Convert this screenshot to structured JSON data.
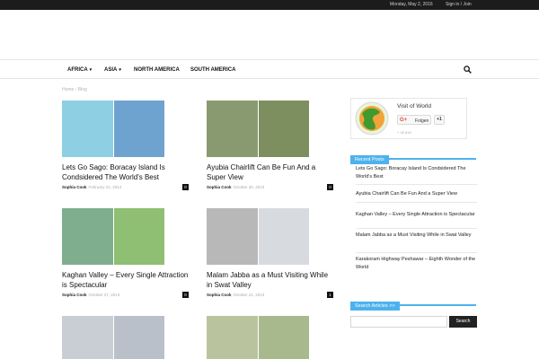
{
  "topbar": {
    "date": "Monday, May 2, 2016",
    "signin": "Sign in / Join"
  },
  "nav": {
    "items": [
      {
        "label": "AFRICA",
        "has_caret": true
      },
      {
        "label": "ASIA",
        "has_caret": true
      },
      {
        "label": "NORTH AMERICA",
        "has_caret": false
      },
      {
        "label": "SOUTH AMERICA",
        "has_caret": false
      }
    ],
    "search_icon": "search-icon"
  },
  "breadcrumb": {
    "home": "Home",
    "sep": "›",
    "current": "Blog"
  },
  "posts": [
    {
      "title": "Lets Go Sago: Boracay Island Is Condsidered The World's Best",
      "author": "Sophia Cook",
      "date": "February 22, 2014",
      "comments": "0",
      "left_color": "#8fcfe3",
      "right_color": "#6fa3cf"
    },
    {
      "title": "Ayubia Chairlift Can Be Fun And a Super View",
      "author": "Sophia Cook",
      "date": "October 30, 2013",
      "comments": "0",
      "left_color": "#8a9a70",
      "right_color": "#7d8f5e"
    },
    {
      "title": "Kaghan Valley – Every Single Attraction is Spectacular",
      "author": "Sophia Cook",
      "date": "October 27, 2013",
      "comments": "0",
      "left_color": "#7fae8e",
      "right_color": "#8fbf72"
    },
    {
      "title": "Malam Jabba as a Must Visiting While in Swat Valley",
      "author": "Sophia Cook",
      "date": "October 21, 2013",
      "comments": "1",
      "left_color": "#b8b8b8",
      "right_color": "#d7dadf"
    },
    {
      "title": "",
      "author": "",
      "date": "",
      "comments": "",
      "left_color": "#c9ced4",
      "right_color": "#b9c0c9"
    },
    {
      "title": "",
      "author": "",
      "date": "",
      "comments": "",
      "left_color": "#b9c49e",
      "right_color": "#a9b98e"
    }
  ],
  "social": {
    "name": "Visit of World",
    "follow": "Folgen",
    "plus_one": "+1",
    "fans": "+ 35 819"
  },
  "recent_posts": {
    "heading": "Recent Posts",
    "items": [
      "Lets Go Sago: Boracay Island Is Condsidered The World's Best",
      "Ayubia Chairlift Can Be Fun And a Super View",
      "Kaghan Valley – Every Single Attraction is Spectacular",
      "Malam Jabba as a Must Visiting While in Swat Valley",
      "Karakoram Highway Peshawar – Eighth Wonder of the World"
    ]
  },
  "search_articles": {
    "heading": "Search Articles >>",
    "button": "Search",
    "placeholder": ""
  },
  "colors": {
    "accent": "#4db2ec",
    "topbar": "#1c1c1c",
    "meta": "#aaaaaa"
  }
}
